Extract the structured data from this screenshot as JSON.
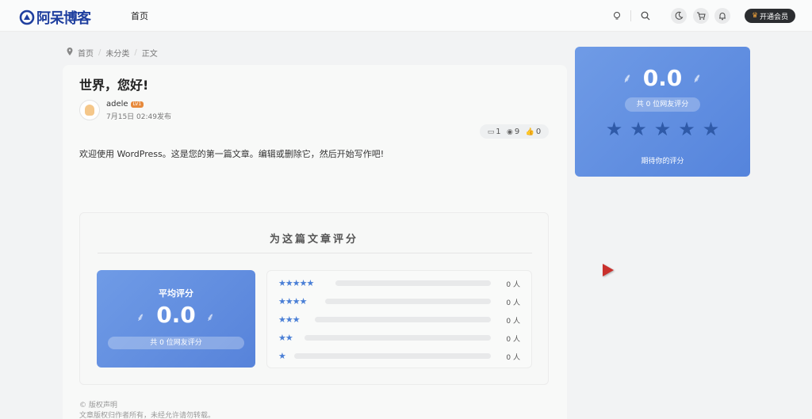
{
  "header": {
    "logo_text": "阿呆博客",
    "nav_home": "首页",
    "vip_label": "开通会员",
    "icons": [
      "bulb-icon",
      "search-icon",
      "moon-icon",
      "cart-icon",
      "bell-icon"
    ]
  },
  "breadcrumb": {
    "items": [
      "首页",
      "未分类",
      "正文"
    ]
  },
  "post": {
    "title": "世界，您好!",
    "author": "adele",
    "level": "LV1",
    "date": "7月15日 02:49发布",
    "comments": "1",
    "views": "9",
    "likes": "0",
    "body": "欢迎使用 WordPress。这是您的第一篇文章。编辑或删除它，然后开始写作吧!"
  },
  "rating": {
    "title": "为这篇文章评分",
    "avg_label": "平均评分",
    "avg_score": "0.0",
    "voters_text": "共 0 位网友评分",
    "rows": [
      {
        "stars": "★★★★★",
        "count": "0 人",
        "fraction": 0
      },
      {
        "stars": "★★★★",
        "count": "0 人",
        "fraction": 0
      },
      {
        "stars": "★★★",
        "count": "0 人",
        "fraction": 0
      },
      {
        "stars": "★★",
        "count": "0 人",
        "fraction": 0
      },
      {
        "stars": "★",
        "count": "0 人",
        "fraction": 0
      }
    ]
  },
  "copyright": {
    "title": "© 版权声明",
    "text": "文章版权归作者所有，未经允许请勿转载。"
  },
  "side": {
    "score": "0.0",
    "voters_text": "共 0 位网友评分",
    "hint": "期待你的评分",
    "star_count": 5
  },
  "colors": {
    "accent": "#5a86dc",
    "star_dark": "#2f5aa8",
    "vip_bg": "#2b2d30"
  }
}
